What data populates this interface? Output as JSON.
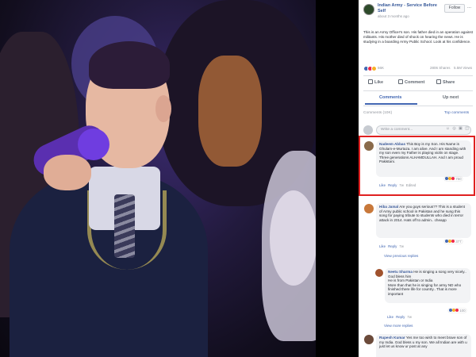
{
  "post": {
    "page_name": "Indian Army - Service Before Self",
    "time": "about 3 months ago",
    "follow_label": "Follow",
    "more": "...",
    "text": "This is an Army Officer's son. His father died in an operation against militants. His mother died of shock on hearing the news. He is studying in a boarding Army Public School. Look at his confidence.",
    "reaction_count": "56K",
    "shares": "2806 Shares",
    "views": "5.5M Views"
  },
  "actions": {
    "like": "Like",
    "comment": "Comment",
    "share": "Share"
  },
  "tabs": {
    "comments": "Comments",
    "up_next": "Up next"
  },
  "comments_meta": {
    "count": "Comments (10K)",
    "sort": "Top comments"
  },
  "write": {
    "placeholder": "Write a comment...",
    "icons": "☺ ◎ ▣ ◫"
  },
  "comments": [
    {
      "name": "Nadeem Abbas",
      "text": "This Boy is my Son. His Name is Ghulam-e-Murtaza. I am alive. And I am standing with my son even my Father is playing violin on stage. Three generations ALHAMDULLAH. And I am proud Pakistani.",
      "like": "Like",
      "reply": "Reply",
      "time": "7w",
      "edited": "Edited",
      "reactions": "750"
    },
    {
      "name": "Hiba Jamal",
      "text": "Are you guys serious?? This is a student of Army public school in Pakistan and he sung this song for paying tribute to students who died in terror attack in 2014. Hats off to admin.. cheapp",
      "like": "Like",
      "reply": "Reply",
      "time": "7w",
      "reactions": "377",
      "view_replies": "View previous replies"
    },
    {
      "name": "Neetu Sharma",
      "text": "He is singing a song very nicely.. God bless him\nHe is from Pakistan or India\nMore than that he is singing for army ND who finished there life for country.. That is more important",
      "like": "Like",
      "reply": "Reply",
      "time": "7w",
      "reactions": "100",
      "view_replies": "View more replies"
    },
    {
      "name": "Rupesh Kumar",
      "text": "Yes me too wish to meet brave son of my India. God bless u my son. We all Indian are with u just let us know ur post at any"
    }
  ],
  "colors": {
    "highlight": "#e02020",
    "link": "#385898",
    "accent": "#4267b2"
  }
}
